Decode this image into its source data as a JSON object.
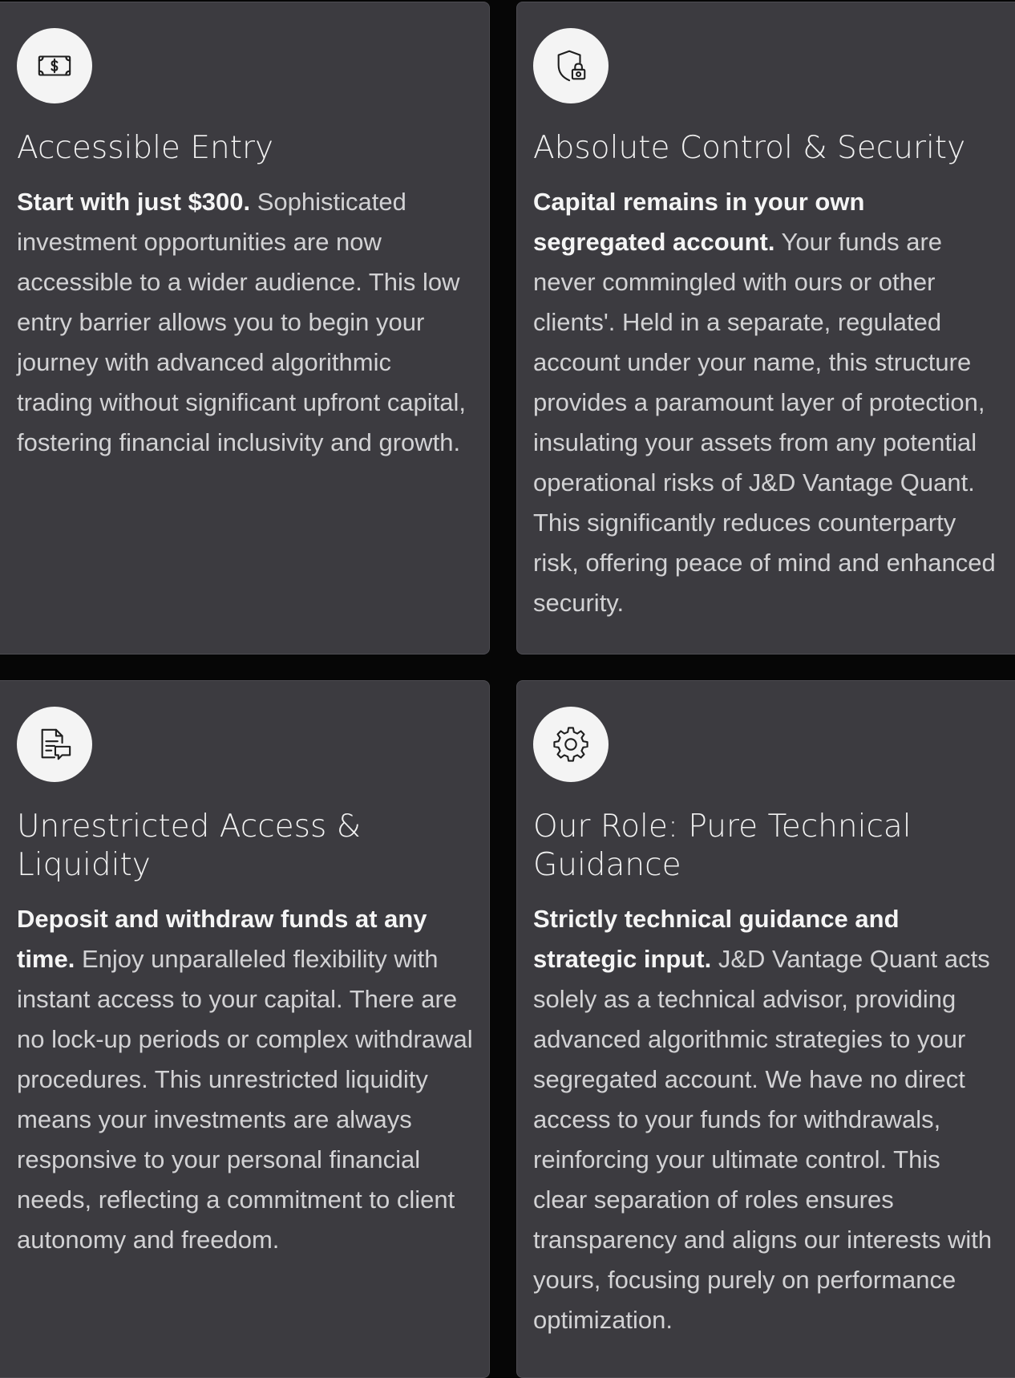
{
  "cards": [
    {
      "icon": "money-bill-icon",
      "title": "Accessible Entry",
      "lead": "Start with just $300.",
      "text": " Sophisticated investment opportunities are now accessible to a wider audience. This low entry barrier allows you to begin your journey with advanced algorithmic trading without significant upfront capital, fostering financial inclusivity and growth."
    },
    {
      "icon": "shield-lock-icon",
      "title": "Absolute Control & Security",
      "lead": "Capital remains in your own segregated account.",
      "text": " Your funds are never commingled with ours or other clients'. Held in a separate, regulated account under your name, this structure provides a paramount layer of protection, insulating your assets from any potential operational risks of J&D Vantage Quant. This significantly reduces counterparty risk, offering peace of mind and enhanced security."
    },
    {
      "icon": "document-chat-icon",
      "title": "Unrestricted Access & Liquidity",
      "lead": "Deposit and withdraw funds at any time.",
      "text": " Enjoy unparalleled flexibility with instant access to your capital. There are no lock-up periods or complex withdrawal procedures. This unrestricted liquidity means your investments are always responsive to your personal financial needs, reflecting a commitment to client autonomy and freedom."
    },
    {
      "icon": "gear-icon",
      "title": "Our Role: Pure Technical Guidance",
      "lead": "Strictly technical guidance and strategic input.",
      "text": " J&D Vantage Quant acts solely as a technical advisor, providing advanced algorithmic strategies to your segregated account. We have no direct access to your funds for withdrawals, reinforcing your ultimate control. This clear separation of roles ensures transparency and aligns our interests with yours, focusing purely on performance optimization."
    }
  ]
}
